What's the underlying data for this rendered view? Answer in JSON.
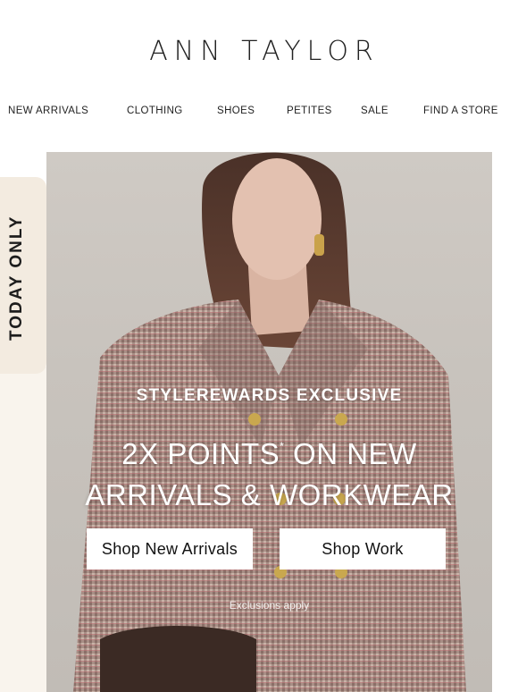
{
  "brand": {
    "logo_text": "ANN TAYLOR"
  },
  "nav": {
    "items": [
      {
        "label": "NEW ARRIVALS"
      },
      {
        "label": "CLOTHING"
      },
      {
        "label": "SHOES"
      },
      {
        "label": "PETITES"
      },
      {
        "label": "SALE"
      },
      {
        "label": "FIND A STORE"
      }
    ]
  },
  "side_tab": {
    "label": "TODAY ONLY"
  },
  "hero": {
    "eyebrow": "STYLEREWARDS EXCLUSIVE",
    "headline_part1": "2X POINTS",
    "headline_sup": "*",
    "headline_part2": " ON NEW ARRIVALS & WORKWEAR",
    "cta_primary": "Shop New Arrivals",
    "cta_secondary": "Shop Work",
    "fine_print": "Exclusions apply"
  },
  "colors": {
    "side_tab_bg": "#f3ebe0",
    "hero_text": "#ffffff",
    "button_bg": "#ffffff"
  }
}
